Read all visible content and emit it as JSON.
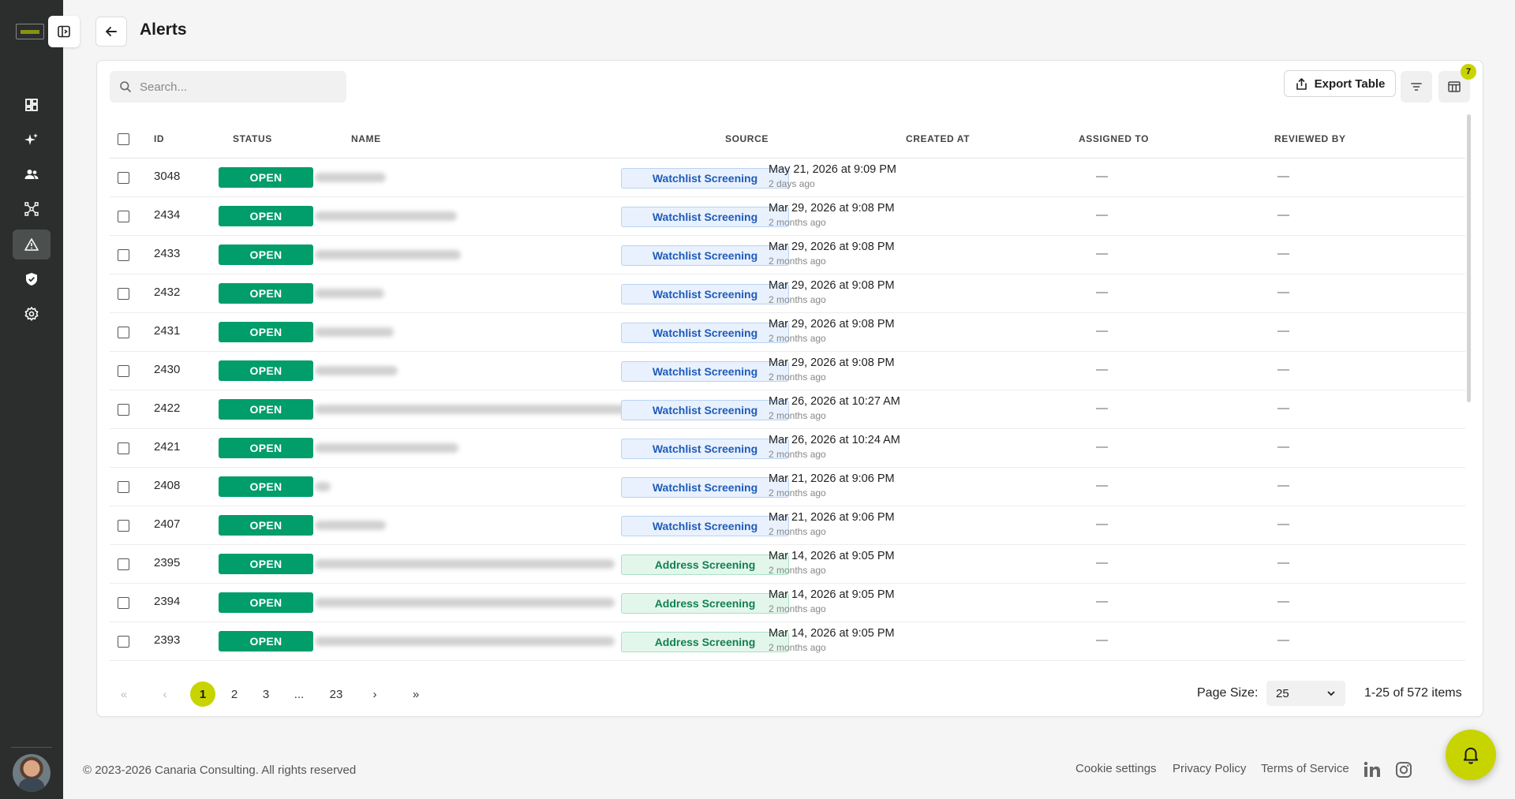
{
  "header": {
    "title": "Alerts"
  },
  "search": {
    "placeholder": "Search..."
  },
  "toolbar": {
    "export_label": "Export Table",
    "columns_badge": "7"
  },
  "columns": [
    "ID",
    "STATUS",
    "NAME",
    "SOURCE",
    "CREATED AT",
    "ASSIGNED TO",
    "REVIEWED BY"
  ],
  "rows": [
    {
      "id": "3048",
      "status": "OPEN",
      "source": "Watchlist Screening",
      "created": "May 21, 2026 at 9:09 PM",
      "ago": "2 days ago",
      "assigned": "—",
      "reviewed": "—"
    },
    {
      "id": "2434",
      "status": "OPEN",
      "source": "Watchlist Screening",
      "created": "Mar 29, 2026 at 9:08 PM",
      "ago": "2 months ago",
      "assigned": "—",
      "reviewed": "—"
    },
    {
      "id": "2433",
      "status": "OPEN",
      "source": "Watchlist Screening",
      "created": "Mar 29, 2026 at 9:08 PM",
      "ago": "2 months ago",
      "assigned": "—",
      "reviewed": "—"
    },
    {
      "id": "2432",
      "status": "OPEN",
      "source": "Watchlist Screening",
      "created": "Mar 29, 2026 at 9:08 PM",
      "ago": "2 months ago",
      "assigned": "—",
      "reviewed": "—"
    },
    {
      "id": "2431",
      "status": "OPEN",
      "source": "Watchlist Screening",
      "created": "Mar 29, 2026 at 9:08 PM",
      "ago": "2 months ago",
      "assigned": "—",
      "reviewed": "—"
    },
    {
      "id": "2430",
      "status": "OPEN",
      "source": "Watchlist Screening",
      "created": "Mar 29, 2026 at 9:08 PM",
      "ago": "2 months ago",
      "assigned": "—",
      "reviewed": "—"
    },
    {
      "id": "2422",
      "status": "OPEN",
      "source": "Watchlist Screening",
      "created": "Mar 26, 2026 at 10:27 AM",
      "ago": "2 months ago",
      "assigned": "—",
      "reviewed": "—"
    },
    {
      "id": "2421",
      "status": "OPEN",
      "source": "Watchlist Screening",
      "created": "Mar 26, 2026 at 10:24 AM",
      "ago": "2 months ago",
      "assigned": "—",
      "reviewed": "—"
    },
    {
      "id": "2408",
      "status": "OPEN",
      "source": "Watchlist Screening",
      "created": "Mar 21, 2026 at 9:06 PM",
      "ago": "2 months ago",
      "assigned": "—",
      "reviewed": "—"
    },
    {
      "id": "2407",
      "status": "OPEN",
      "source": "Watchlist Screening",
      "created": "Mar 21, 2026 at 9:06 PM",
      "ago": "2 months ago",
      "assigned": "—",
      "reviewed": "—"
    },
    {
      "id": "2395",
      "status": "OPEN",
      "source": "Address Screening",
      "created": "Mar 14, 2026 at 9:05 PM",
      "ago": "2 months ago",
      "assigned": "—",
      "reviewed": "—"
    },
    {
      "id": "2394",
      "status": "OPEN",
      "source": "Address Screening",
      "created": "Mar 14, 2026 at 9:05 PM",
      "ago": "2 months ago",
      "assigned": "—",
      "reviewed": "—"
    },
    {
      "id": "2393",
      "status": "OPEN",
      "source": "Address Screening",
      "created": "Mar 14, 2026 at 9:05 PM",
      "ago": "2 months ago",
      "assigned": "—",
      "reviewed": "—"
    }
  ],
  "pagination": {
    "first": "«",
    "prev": "‹",
    "pages": [
      "1",
      "2",
      "3",
      "...",
      "23"
    ],
    "current": "1",
    "next": "›",
    "last": "»",
    "page_size_label": "Page Size:",
    "page_size": "25",
    "items": "1-25 of 572 items"
  },
  "footer": {
    "copyright": "© 2023-2026 Canaria Consulting. All rights reserved",
    "links": [
      "Cookie settings",
      "Privacy Policy",
      "Terms of Service"
    ]
  },
  "icons": [
    "dashboard-icon",
    "sparkle-icon",
    "users-icon",
    "network-icon",
    "alert-icon",
    "shield-icon",
    "gear-icon",
    "bell-icon",
    "linkedin-icon",
    "instagram-icon"
  ],
  "colors": {
    "accent": "#c8d400",
    "status_open": "#019d6a",
    "sidebar": "#2b2e2d",
    "watchlist": "#1f5bb8",
    "address": "#12804f"
  }
}
